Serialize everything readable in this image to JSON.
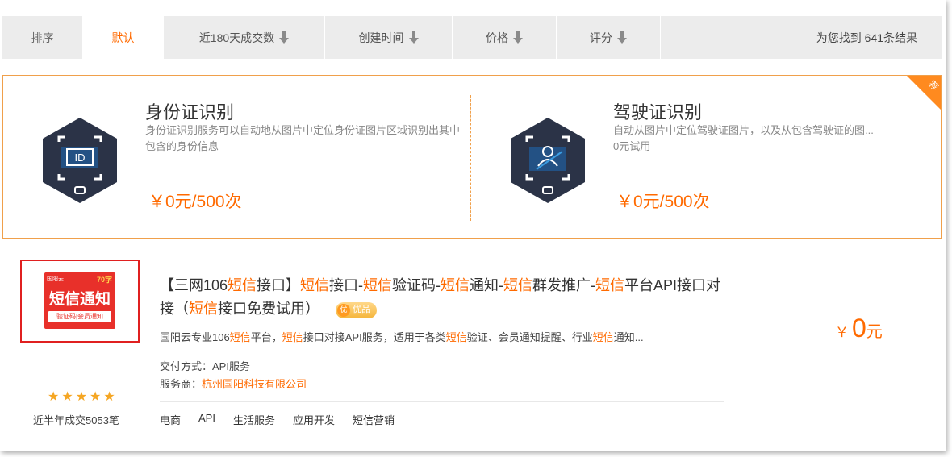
{
  "sort": {
    "label": "排序",
    "items": [
      {
        "label": "默认",
        "active": true,
        "arrow": false
      },
      {
        "label": "近180天成交数",
        "active": false,
        "arrow": true
      },
      {
        "label": "创建时间",
        "active": false,
        "arrow": true
      },
      {
        "label": "价格",
        "active": false,
        "arrow": true
      },
      {
        "label": "评分",
        "active": false,
        "arrow": true
      }
    ],
    "result_text": "为您找到 641条结果"
  },
  "featured": {
    "corner_tag": "荐",
    "items": [
      {
        "title": "身份证识别",
        "desc": "身份证识别服务可以自动地从图片中定位身份证图片区域识别出其中包含的身份信息",
        "price": "￥0元/500次",
        "icon": "id-card-icon"
      },
      {
        "title": "驾驶证识别",
        "desc": "自动从图片中定位驾驶证图片，以及从包含驾驶证的图...",
        "desc2": "0元试用",
        "price": "￥0元/500次",
        "icon": "driver-license-icon"
      }
    ]
  },
  "product": {
    "thumb": {
      "brand": "国阳云",
      "badge": "70字",
      "main": "短信通知",
      "sub": "验证码|会员通知"
    },
    "stars": 5,
    "deal_count": "近半年成交5053笔",
    "title_parts": [
      "【三网106",
      "短信",
      "接口】",
      "短信",
      "接口-",
      "短信",
      "验证码-",
      "短信",
      "通知-",
      "短信",
      "群发推广-",
      "短信",
      "平台API接口对接（",
      "短信",
      "接口免费试用）"
    ],
    "badge": {
      "circle": "优",
      "label": "优品"
    },
    "desc_parts": [
      "国阳云专业106",
      "短信",
      "平台，",
      "短信",
      "接口对接API服务，适用于各类",
      "短信",
      "验证、会员通知提醒、行业",
      "短信",
      "通知..."
    ],
    "delivery_label": "交付方式：",
    "delivery_value": "API服务",
    "provider_label": "服务商：",
    "provider_value": "杭州国阳科技有限公司",
    "tags": [
      "电商",
      "API",
      "生活服务",
      "应用开发",
      "短信营销"
    ],
    "price_symbol": "￥",
    "price_value": "0",
    "price_unit": "元"
  },
  "colors": {
    "accent": "#ff6a00",
    "border": "#f0a04b",
    "star": "#f5a623"
  }
}
